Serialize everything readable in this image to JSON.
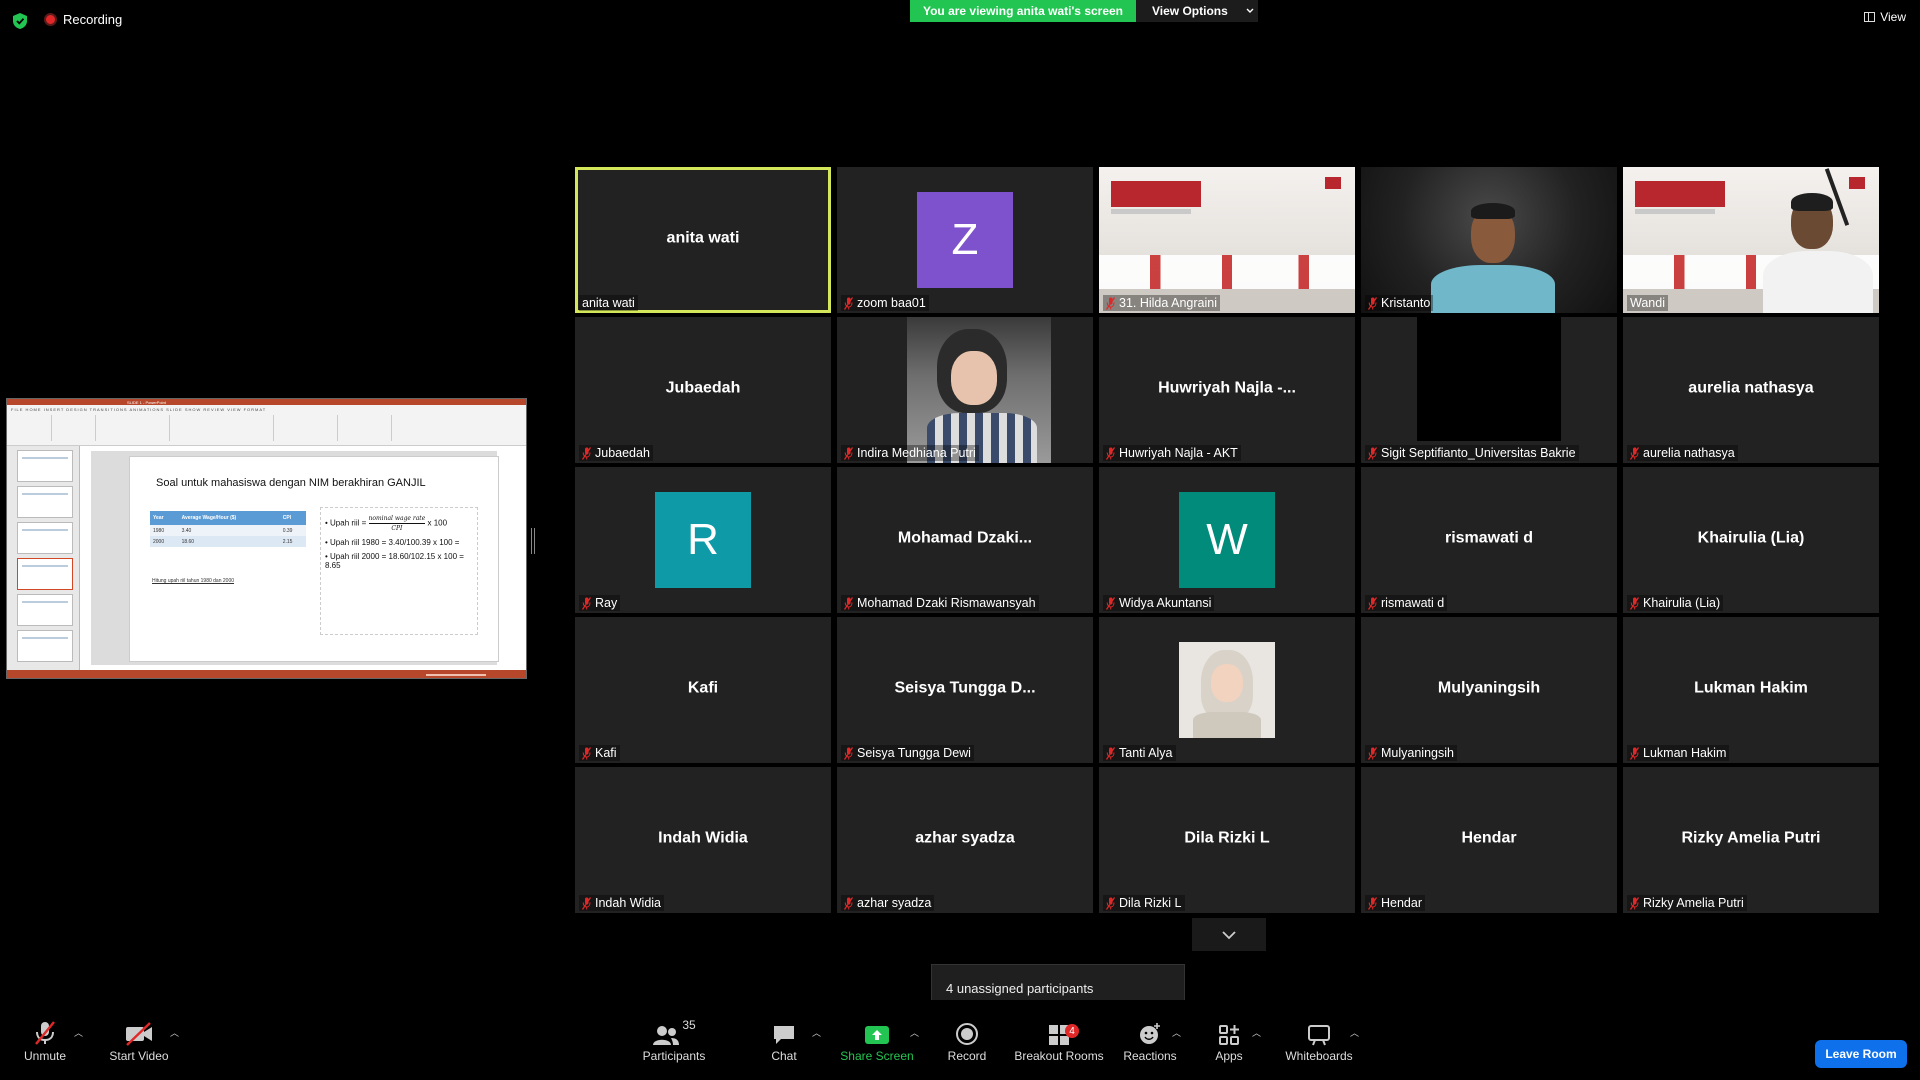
{
  "top": {
    "recording_label": "Recording",
    "viewing_banner": "You are viewing anita wati's screen",
    "view_options_label": "View Options",
    "view_label": "View"
  },
  "shared_slide": {
    "window_title": "SLIDE 1 - PowerPoint",
    "ribbon_tabs": "FILE  HOME  INSERT  DESIGN  TRANSITIONS  ANIMATIONS  SLIDE SHOW  REVIEW  VIEW  FORMAT",
    "title": "Soal untuk mahasiswa dengan NIM berakhiran GANJIL",
    "table_headers": [
      "Year",
      "Average Wage/Hour ($)",
      "CPI"
    ],
    "table_rows": [
      [
        "1980",
        "3.40",
        "0.39"
      ],
      [
        "2000",
        "18.60",
        "2.15"
      ]
    ],
    "note": "Hitung upah riil tahun 1980 dan 2000",
    "formula_prefix": "Upah riil = ",
    "formula_num": "nominal wage rate",
    "formula_den": "CPI",
    "formula_suffix": " x 100",
    "bullet_2": "Upah riil 1980 = 3.40/100.39 x 100 =",
    "bullet_3": "Upah riil 2000 = 18.60/102.15 x 100 = 8.65"
  },
  "colors": {
    "active_speaker": "#d4e65a",
    "banner_green": "#23c552",
    "avatar_z": "#7e52cc",
    "avatar_teal": "#0e9aa7",
    "avatar_w": "#008b7a",
    "leave_blue": "#0e71eb",
    "mute_red": "#e02828"
  },
  "participants": [
    {
      "label": "anita wati",
      "center": "anita wati",
      "muted": false,
      "active": true
    },
    {
      "label": "zoom baa01",
      "avatar": "Z",
      "avatar_color": "#7e52cc",
      "muted": true
    },
    {
      "label": "31. Hilda Angraini",
      "video": "slide-room",
      "muted": true
    },
    {
      "label": "Kristanto",
      "video": "person-dark",
      "muted": true
    },
    {
      "label": "Wandi",
      "video": "slide-room-person",
      "muted": false
    },
    {
      "label": "Jubaedah",
      "center": "Jubaedah",
      "muted": true
    },
    {
      "label": "Indira Medhiana Putri",
      "video": "photo-girl",
      "muted": true
    },
    {
      "label": "Huwriyah Najla - AKT",
      "center": "Huwriyah Najla -...",
      "muted": true
    },
    {
      "label": "Sigit Septifianto_Universitas Bakrie",
      "video": "black",
      "muted": true
    },
    {
      "label": "aurelia nathasya",
      "center": "aurelia nathasya",
      "muted": true
    },
    {
      "label": "Ray",
      "avatar": "R",
      "avatar_color": "#0e9aa7",
      "muted": true
    },
    {
      "label": "Mohamad Dzaki Rismawansyah",
      "center": "Mohamad Dzaki...",
      "muted": true
    },
    {
      "label": "Widya Akuntansi",
      "avatar": "W",
      "avatar_color": "#008b7a",
      "muted": true
    },
    {
      "label": "rismawati d",
      "center": "rismawati d",
      "muted": true
    },
    {
      "label": "Khairulia (Lia)",
      "center": "Khairulia (Lia)",
      "muted": true
    },
    {
      "label": "Kafi",
      "center": "Kafi",
      "muted": true
    },
    {
      "label": "Seisya Tungga Dewi",
      "center": "Seisya Tungga D...",
      "muted": true
    },
    {
      "label": "Tanti Alya",
      "video": "photo-hijab",
      "muted": true
    },
    {
      "label": "Mulyaningsih",
      "center": "Mulyaningsih",
      "muted": true
    },
    {
      "label": "Lukman Hakim",
      "center": "Lukman Hakim",
      "muted": true
    },
    {
      "label": "Indah Widia",
      "center": "Indah Widia",
      "muted": true
    },
    {
      "label": "azhar syadza",
      "center": "azhar syadza",
      "muted": true
    },
    {
      "label": "Dila Rizki L",
      "center": "Dila Rizki L",
      "muted": true
    },
    {
      "label": "Hendar",
      "center": "Hendar",
      "muted": true
    },
    {
      "label": "Rizky Amelia Putri",
      "center": "Rizky Amelia Putri",
      "muted": true
    }
  ],
  "toast": "4 unassigned participants",
  "toolbar": {
    "unmute": "Unmute",
    "start_video": "Start Video",
    "participants": "Participants",
    "participants_count": "35",
    "chat": "Chat",
    "share_screen": "Share Screen",
    "record": "Record",
    "breakout_rooms": "Breakout Rooms",
    "breakout_badge": "4",
    "reactions": "Reactions",
    "apps": "Apps",
    "whiteboards": "Whiteboards",
    "leave_room": "Leave Room"
  }
}
